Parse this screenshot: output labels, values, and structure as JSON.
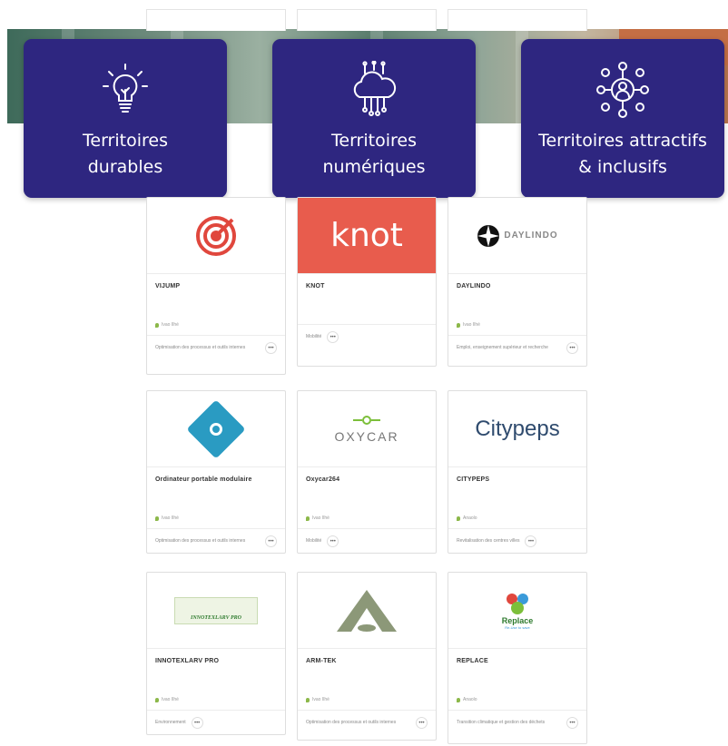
{
  "themes": [
    {
      "title": "Territoires\ndurables",
      "icon": "lightbulb-icon"
    },
    {
      "title": "Territoires\nnumériques",
      "icon": "cloud-circuit-icon"
    },
    {
      "title": "Territoires attractifs\n& inclusifs",
      "icon": "people-network-icon"
    }
  ],
  "solutions": [
    {
      "name": "VIJUMP",
      "logo_text": "",
      "location": "Ivao Ilhé",
      "tag": "Optimisation des processus et outils internes"
    },
    {
      "name": "KNOT",
      "logo_text": "knot",
      "location": "",
      "tag": "Mobilité"
    },
    {
      "name": "DAYLINDO",
      "logo_text": "DAYLINDO",
      "location": "Ivao Ilhé",
      "tag": "Emploi, enseignement supérieur et recherche"
    },
    {
      "name": "Ordinateur portable modulaire",
      "logo_text": "",
      "location": "Ivao Ilhé",
      "tag": "Optimisation des processus et outils internes"
    },
    {
      "name": "Oxycar264",
      "logo_text": "OXYCAR",
      "location": "Ivao Ilhé",
      "tag": "Mobilité"
    },
    {
      "name": "CITYPEPS",
      "logo_text": "Citypeps",
      "location": "Anaolo",
      "tag": "Revitalisation des centres villes"
    },
    {
      "name": "INNOTEXLARV PRO",
      "logo_text": "INNOTEXLARV PRO",
      "location": "Ivao Ilhé",
      "tag": "Environnement"
    },
    {
      "name": "ARM-TEK",
      "logo_text": "",
      "location": "Ivao Ilhé",
      "tag": "Optimisation des processus et outils internes"
    },
    {
      "name": "REPLACE",
      "logo_text": "Replace",
      "logo_sub": "Re-Use to save",
      "location": "Anaolo",
      "tag": "Transition climatique et gestion des déchets"
    }
  ],
  "colors": {
    "theme_bg": "#2e2680",
    "knot_bg": "#e85c4d",
    "location_pin": "#8cb84a"
  }
}
